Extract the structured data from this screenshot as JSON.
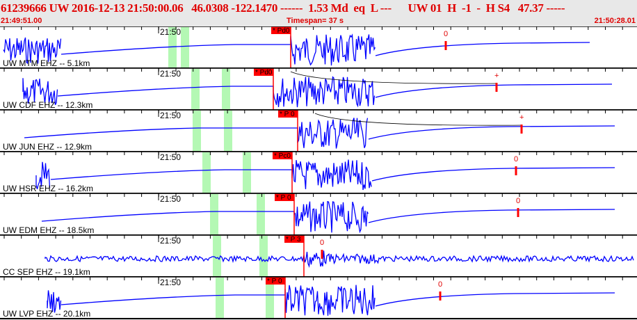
{
  "header": {
    "title": "61239666 UW 2016-12-13 21:50:00.06   46.0308 -122.1470 ------  1.53 Md  eq  L ---      UW 01  H  -1  -  H S4   47.37 -----",
    "start_time": "21:49:51.00",
    "timespan": "Timespan=  37 s",
    "end_time": "21:50:28.01"
  },
  "time_tick_label": "21:50",
  "colors": {
    "trace": "#0000ff",
    "pick": "#ff0000",
    "window": "#b4f8b4",
    "text": "#e00000"
  },
  "channels": [
    {
      "label": "UW MTM EHZ -- 5.1km",
      "pick": "* Pd0",
      "coda": "0",
      "time_label": "21:50"
    },
    {
      "label": "UW CDF EHZ -- 12.3km",
      "pick": "* Pd0",
      "coda": "+",
      "time_label": "21:50"
    },
    {
      "label": "UW JUN EHZ -- 12.9km",
      "pick": "* P 0",
      "coda": "+",
      "time_label": "21:50"
    },
    {
      "label": "UW HSR EHZ -- 16.2km",
      "pick": "* Pc0",
      "coda": "0",
      "time_label": "21:50"
    },
    {
      "label": "UW EDM EHZ -- 18.5km",
      "pick": "* P 0",
      "coda": "0",
      "time_label": "21:50"
    },
    {
      "label": "CC SEP EHZ -- 19.1km",
      "pick": "* P 3",
      "coda": "0",
      "time_label": "21:50"
    },
    {
      "label": "UW LVP EHZ -- 20.1km",
      "pick": "* P 0",
      "coda": "0",
      "time_label": "21:50"
    }
  ]
}
